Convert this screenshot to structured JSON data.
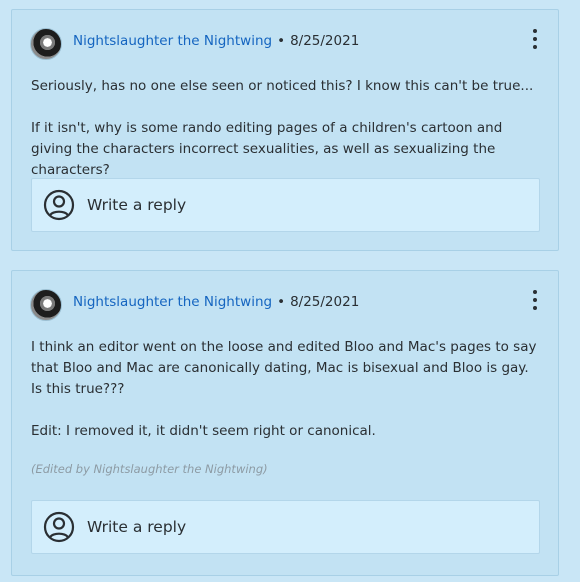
{
  "posts": [
    {
      "author": "Nightslaughter the Nightwing",
      "separator": "•",
      "date": "8/25/2021",
      "paragraphs": [
        "Seriously, has no one else seen or noticed this? I know this can't be true...",
        "If it isn't, why is some rando editing pages of a children's cartoon and giving the characters incorrect sexualities, as well as sexualizing the characters?"
      ],
      "reply_placeholder": "Write a reply",
      "avatar_icon": "dragon-avatar",
      "menu_icon": "kebab-menu-icon",
      "reply_icon": "user-circle-icon"
    },
    {
      "author": "Nightslaughter the Nightwing",
      "separator": "•",
      "date": "8/25/2021",
      "paragraphs": [
        "I think an editor went on the loose and edited Bloo and Mac's pages to say that Bloo and Mac are canonically dating, Mac is bisexual and Bloo is gay. Is this true???",
        "Edit: I removed it, it didn't seem right or canonical."
      ],
      "edited_note": "(Edited by Nightslaughter the Nightwing)",
      "reply_placeholder": "Write a reply",
      "avatar_icon": "dragon-avatar",
      "menu_icon": "kebab-menu-icon",
      "reply_icon": "user-circle-icon"
    }
  ],
  "colors": {
    "author_link": "#1565c0",
    "card_bg": "#c2e2f3",
    "reply_bg": "#d3eefc"
  }
}
